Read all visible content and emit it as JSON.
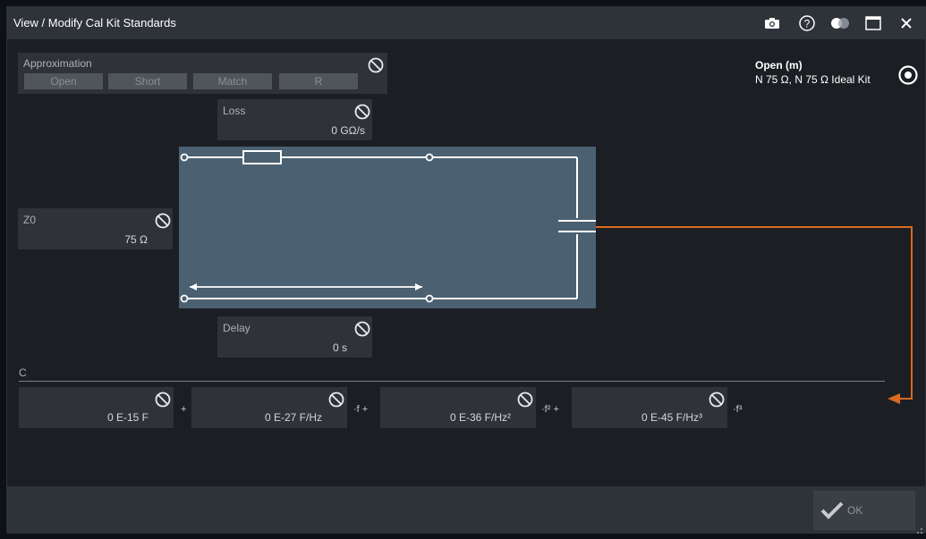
{
  "window": {
    "title": "View / Modify Cal Kit Standards"
  },
  "titlebar_icons": [
    "camera-icon",
    "help-icon",
    "toggle-icon",
    "maximize-icon",
    "close-icon"
  ],
  "approximation": {
    "label": "Approximation",
    "options": [
      "Open",
      "Short",
      "Match",
      "R"
    ]
  },
  "standard": {
    "name": "Open (m)",
    "kit": "N 75 Ω, N 75 Ω Ideal Kit"
  },
  "loss": {
    "label": "Loss",
    "value": "0 GΩ/s"
  },
  "z0": {
    "label": "Z0",
    "value": "75 Ω"
  },
  "delay": {
    "label": "Delay",
    "value": "0 s"
  },
  "c_section": {
    "label": "C",
    "terms": [
      {
        "value": "0 E-15 F",
        "suffix": "+"
      },
      {
        "value": "0 E-27 F/Hz",
        "suffix": "·f +"
      },
      {
        "value": "0 E-36 F/Hz²",
        "suffix": "·f² +"
      },
      {
        "value": "0 E-45 F/Hz³",
        "suffix": "·f³"
      }
    ]
  },
  "footer": {
    "ok_label": "OK"
  },
  "colors": {
    "accent": "#d96a1f",
    "schematic_bg": "#4b6070",
    "panel": "#2f3339",
    "window": "#1b1f24"
  }
}
